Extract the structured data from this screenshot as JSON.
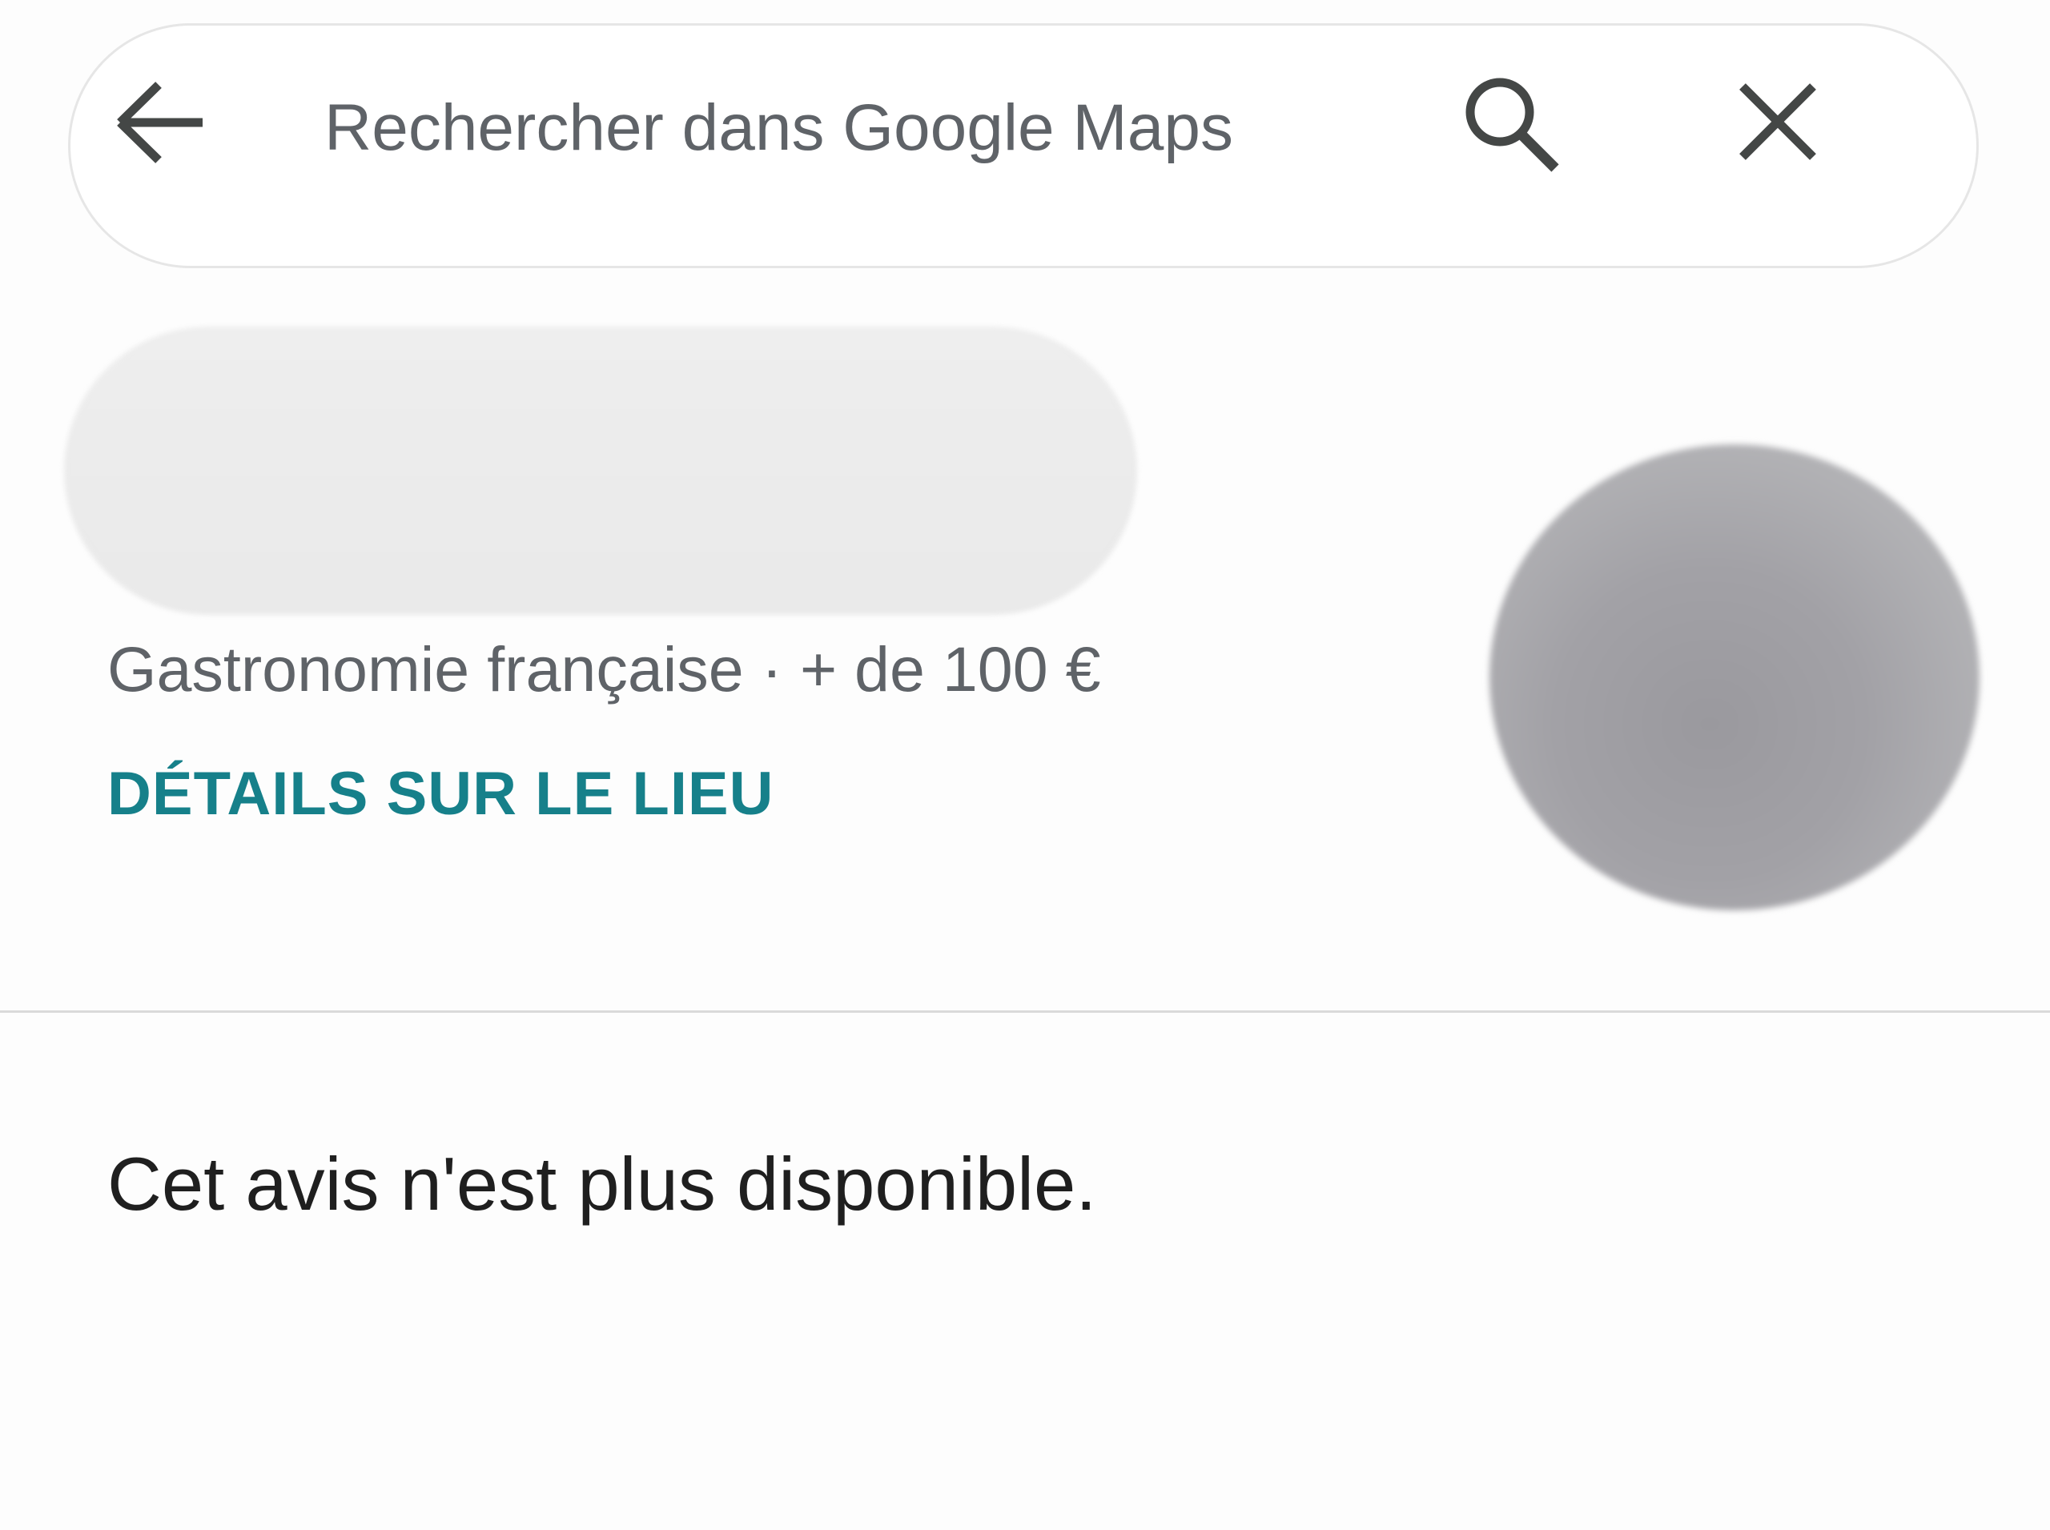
{
  "search": {
    "placeholder": "Rechercher dans Google Maps"
  },
  "icons": {
    "back": "arrow-back-icon",
    "search": "search-icon",
    "close": "close-icon"
  },
  "place": {
    "category": "Gastronomie française · + de 100 €",
    "details_label": "DÉTAILS SUR LE LIEU"
  },
  "review": {
    "message": "Cet avis n'est plus disponible."
  },
  "colors": {
    "accent": "#16808a",
    "secondary_text": "#5f6368",
    "primary_text": "#1f1f1f"
  }
}
